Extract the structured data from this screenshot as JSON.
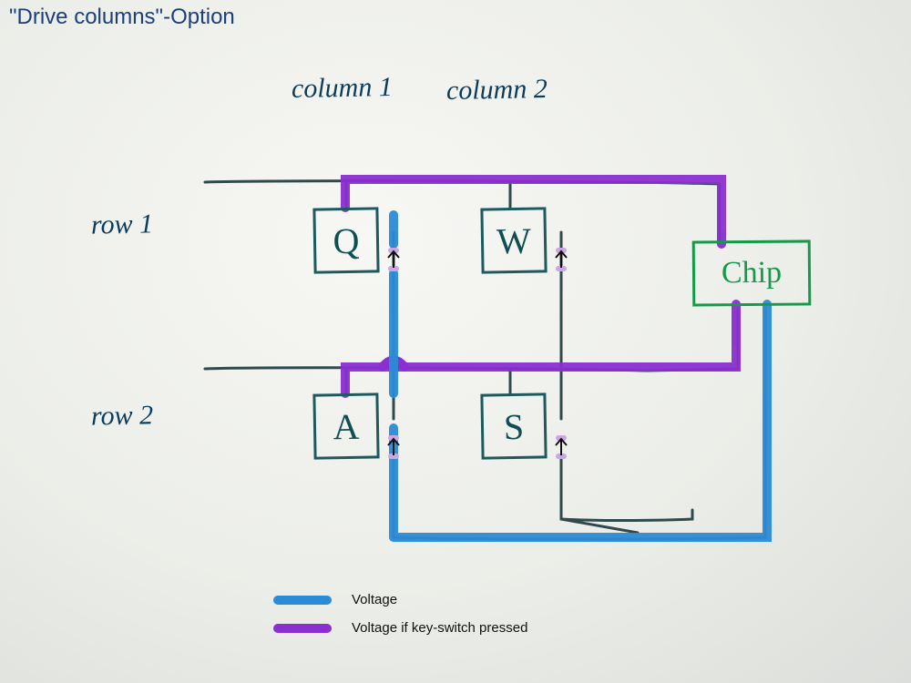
{
  "title": "\"Drive columns\"-Option",
  "labels": {
    "col1": "column 1",
    "col2": "column 2",
    "row1": "row 1",
    "row2": "row 2"
  },
  "keys": {
    "q": "Q",
    "w": "W",
    "a": "A",
    "s": "S"
  },
  "chip": "Chip",
  "legend": {
    "voltage": "Voltage",
    "voltage_pressed": "Voltage if key-switch pressed"
  },
  "colors": {
    "voltage": "#2b8bd6",
    "voltage_pressed": "#8a2fd0",
    "ink": "#1d5a5e",
    "chip": "#159a4a"
  }
}
